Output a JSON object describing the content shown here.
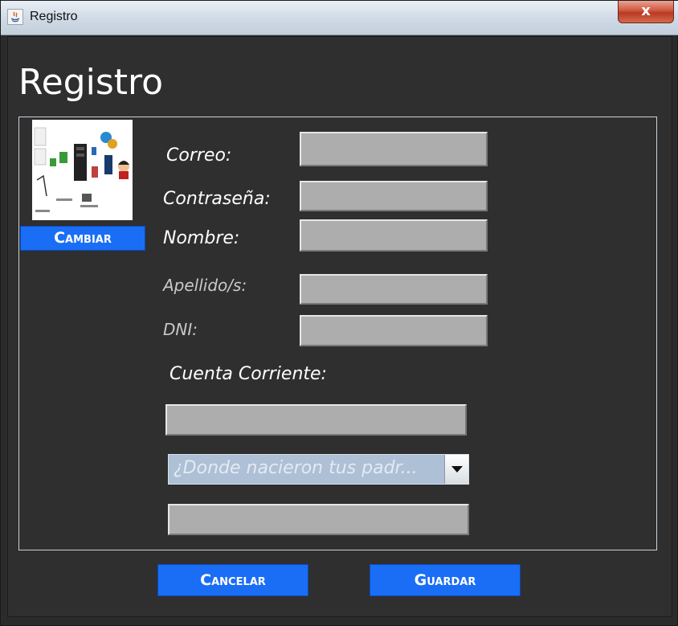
{
  "window": {
    "title": "Registro",
    "close_glyph": "x",
    "app_icon": "java-icon"
  },
  "form": {
    "heading": "Registro",
    "change_button": "Cambiar",
    "labels": {
      "correo": "Correo:",
      "contrasena": "Contraseña:",
      "nombre": "Nombre:",
      "apellidos": "Apellido/s:",
      "dni": "DNI:",
      "cuenta": "Cuenta Corriente:"
    },
    "values": {
      "correo": "",
      "contrasena": "",
      "nombre": "",
      "apellidos": "",
      "dni": "",
      "cuenta": "",
      "respuesta": ""
    },
    "security_question": "¿Donde nacieron tus padr..."
  },
  "actions": {
    "cancel": "Cancelar",
    "save": "Guardar"
  },
  "colors": {
    "accent": "#1a6ef5",
    "background": "#2f2f2f",
    "field": "#adadad"
  }
}
